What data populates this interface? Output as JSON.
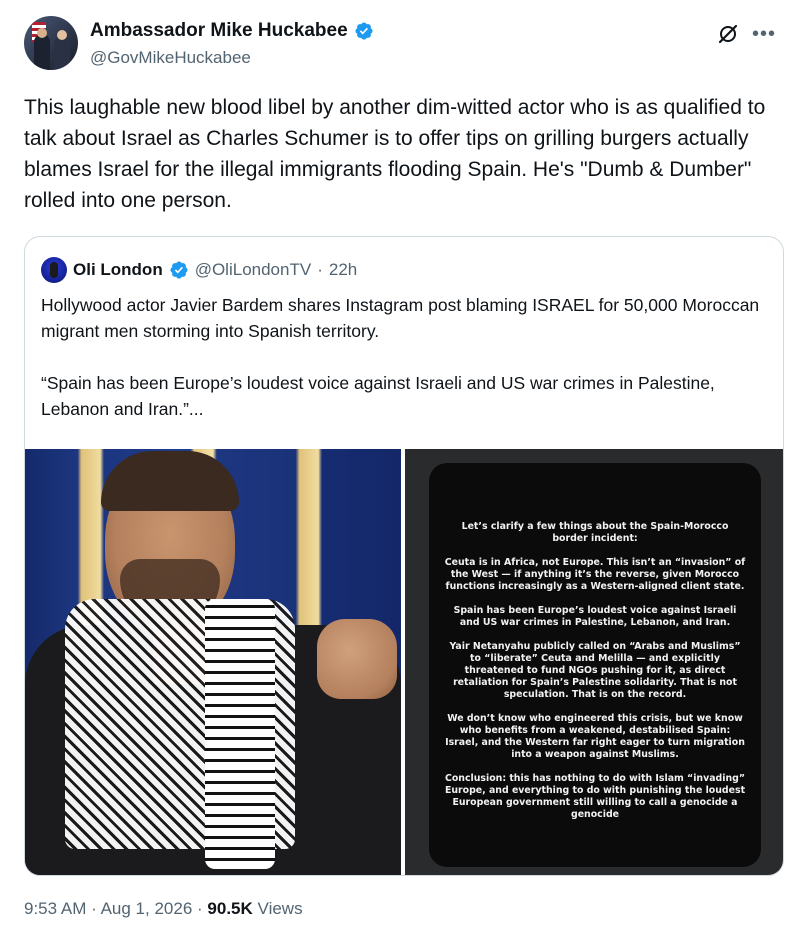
{
  "author": {
    "display_name": "Ambassador Mike Huckabee",
    "handle": "@GovMikeHuckabee",
    "verified_color": "#1d9bf0"
  },
  "tweet": {
    "text": "This laughable new blood libel by another dim-witted actor who is as qualified to talk about Israel as Charles Schumer is to offer tips on grilling burgers actually blames Israel for the illegal immigrants flooding Spain. He's \"Dumb & Dumber\" rolled into one person."
  },
  "quoted": {
    "display_name": "Oli London",
    "handle": "@OliLondonTV",
    "separator": "·",
    "time": "22h",
    "paragraph1": "Hollywood actor Javier Bardem shares Instagram post blaming ISRAEL for 50,000 Moroccan migrant men storming into Spanish territory.",
    "paragraph2": "“Spain has been Europe’s loudest voice against Israeli and US war crimes in Palestine, Lebanon and Iran.”...",
    "story": {
      "heading": "Let’s clarify a few things about the Spain-Morocco border incident:",
      "p1": "Ceuta is in Africa, not Europe. This isn’t an “invasion” of the West — if anything it’s the reverse, given Morocco functions increasingly as a Western-aligned client state.",
      "p2": "Spain has been Europe’s loudest voice against Israeli and US war crimes in Palestine, Lebanon, and Iran.",
      "p3": "Yair Netanyahu publicly called on “Arabs and Muslims” to “liberate” Ceuta and Melilla — and explicitly threatened to fund NGOs pushing for it, as direct retaliation for Spain’s Palestine solidarity. That is not speculation. That is on the record.",
      "p4": "We don’t know who engineered this crisis, but we know who benefits from a weakened, destabilised Spain: Israel, and the Western far right eager to turn migration into a weapon against Muslims.",
      "p5": "Conclusion: this has nothing to do with Islam “invading” Europe, and everything to do with punishing the loudest European government still willing to call a genocide a genocide"
    }
  },
  "footer": {
    "time": "9:53 AM",
    "sep1": "·",
    "date": "Aug 1, 2026",
    "sep2": "·",
    "views_count": "90.5K",
    "views_label": "Views"
  },
  "icons": {
    "verified": "verified-badge-icon",
    "grok": "grok-icon",
    "more": "more-icon"
  }
}
